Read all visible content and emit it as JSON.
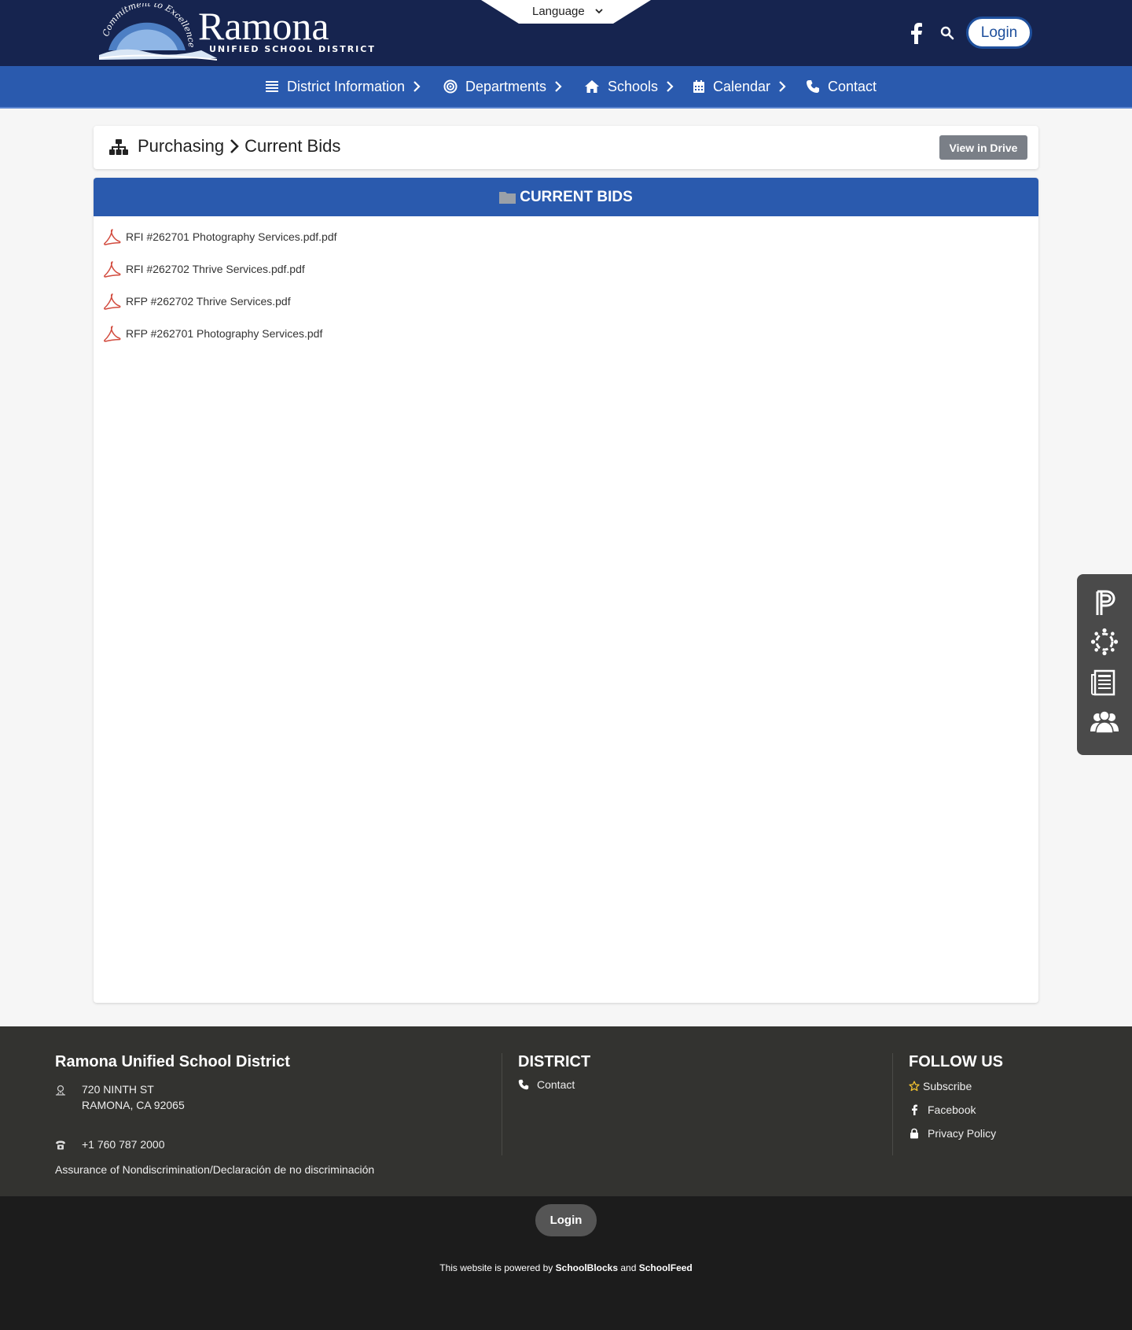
{
  "header": {
    "logo": {
      "motto": "Commitment to Excellence",
      "name": "Ramona",
      "subtitle": "UNIFIED SCHOOL DISTRICT"
    },
    "language_label": "Language",
    "login_label": "Login",
    "icons": [
      "facebook-icon",
      "search-icon"
    ]
  },
  "nav": {
    "items": [
      {
        "label": "District Information",
        "icon": "list-icon",
        "has_submenu": true
      },
      {
        "label": "Departments",
        "icon": "target-icon",
        "has_submenu": true
      },
      {
        "label": "Schools",
        "icon": "home-icon",
        "has_submenu": true
      },
      {
        "label": "Calendar",
        "icon": "calendar-icon",
        "has_submenu": true
      },
      {
        "label": "Contact",
        "icon": "phone-icon",
        "has_submenu": false
      }
    ]
  },
  "breadcrumb": {
    "parent": "Purchasing",
    "current": "Current Bids",
    "drive_button": "View in Drive"
  },
  "folder": {
    "title": "CURRENT BIDS",
    "files": [
      {
        "name": "RFI #262701 Photography Services.pdf.pdf"
      },
      {
        "name": "RFI #262702 Thrive Services.pdf.pdf"
      },
      {
        "name": "RFP #262702 Thrive Services.pdf"
      },
      {
        "name": "RFP #262701 Photography Services.pdf"
      }
    ]
  },
  "quicklinks": [
    "powerschool-icon",
    "canvas-icon",
    "newsletter-icon",
    "community-icon"
  ],
  "footer": {
    "district_name": "Ramona Unified School District",
    "address_line1": "720 NINTH ST",
    "address_line2": "RAMONA, CA 92065",
    "phone": "+1 760 787 2000",
    "nondiscrimination": "Assurance of Nondiscrimination/Declaración de no discriminación",
    "district_heading": "DISTRICT",
    "district_links": [
      {
        "label": "Contact"
      }
    ],
    "follow_heading": "FOLLOW US",
    "follow_links": [
      {
        "label": "Subscribe"
      },
      {
        "label": "Facebook"
      },
      {
        "label": "Privacy Policy"
      }
    ]
  },
  "bottom": {
    "login_label": "Login",
    "powered_prefix": "This website is powered by",
    "brand1": "SchoolBlocks",
    "joiner": "and",
    "brand2": "SchoolFeed"
  },
  "colors": {
    "header_bg": "#16244f",
    "nav_bg": "#2a5aae",
    "footer_bg": "#333330",
    "bottom_bg": "#1c1c1c",
    "pdf_red": "#d24b3e"
  }
}
